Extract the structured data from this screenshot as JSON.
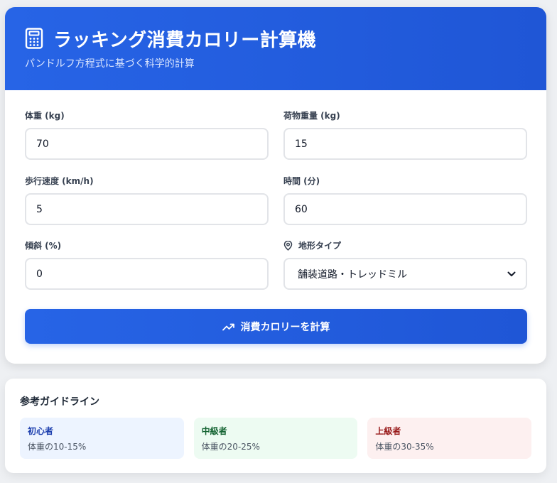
{
  "header": {
    "title": "ラッキング消費カロリー計算機",
    "subtitle": "パンドルフ方程式に基づく科学的計算",
    "icon": "calculator-icon"
  },
  "form": {
    "weight": {
      "label": "体重 (kg)",
      "value": "70"
    },
    "load": {
      "label": "荷物重量 (kg)",
      "value": "15"
    },
    "speed": {
      "label": "歩行速度 (km/h)",
      "value": "5"
    },
    "time": {
      "label": "時間 (分)",
      "value": "60"
    },
    "grade": {
      "label": "傾斜 (%)",
      "value": "0"
    },
    "terrain": {
      "label": "地形タイプ",
      "icon": "map-pin-icon",
      "selected": "舗装道路・トレッドミル"
    }
  },
  "calculate_button": {
    "label": "消費カロリーを計算",
    "icon": "trending-up-icon"
  },
  "guidelines": {
    "title": "参考ガイドライン",
    "levels": [
      {
        "name": "初心者",
        "desc": "体重の10-15%",
        "color": "#1e40af"
      },
      {
        "name": "中級者",
        "desc": "体重の20-25%",
        "color": "#166534"
      },
      {
        "name": "上級者",
        "desc": "体重の30-35%",
        "color": "#991b1b"
      }
    ]
  },
  "colors": {
    "accent": "#2563eb"
  }
}
